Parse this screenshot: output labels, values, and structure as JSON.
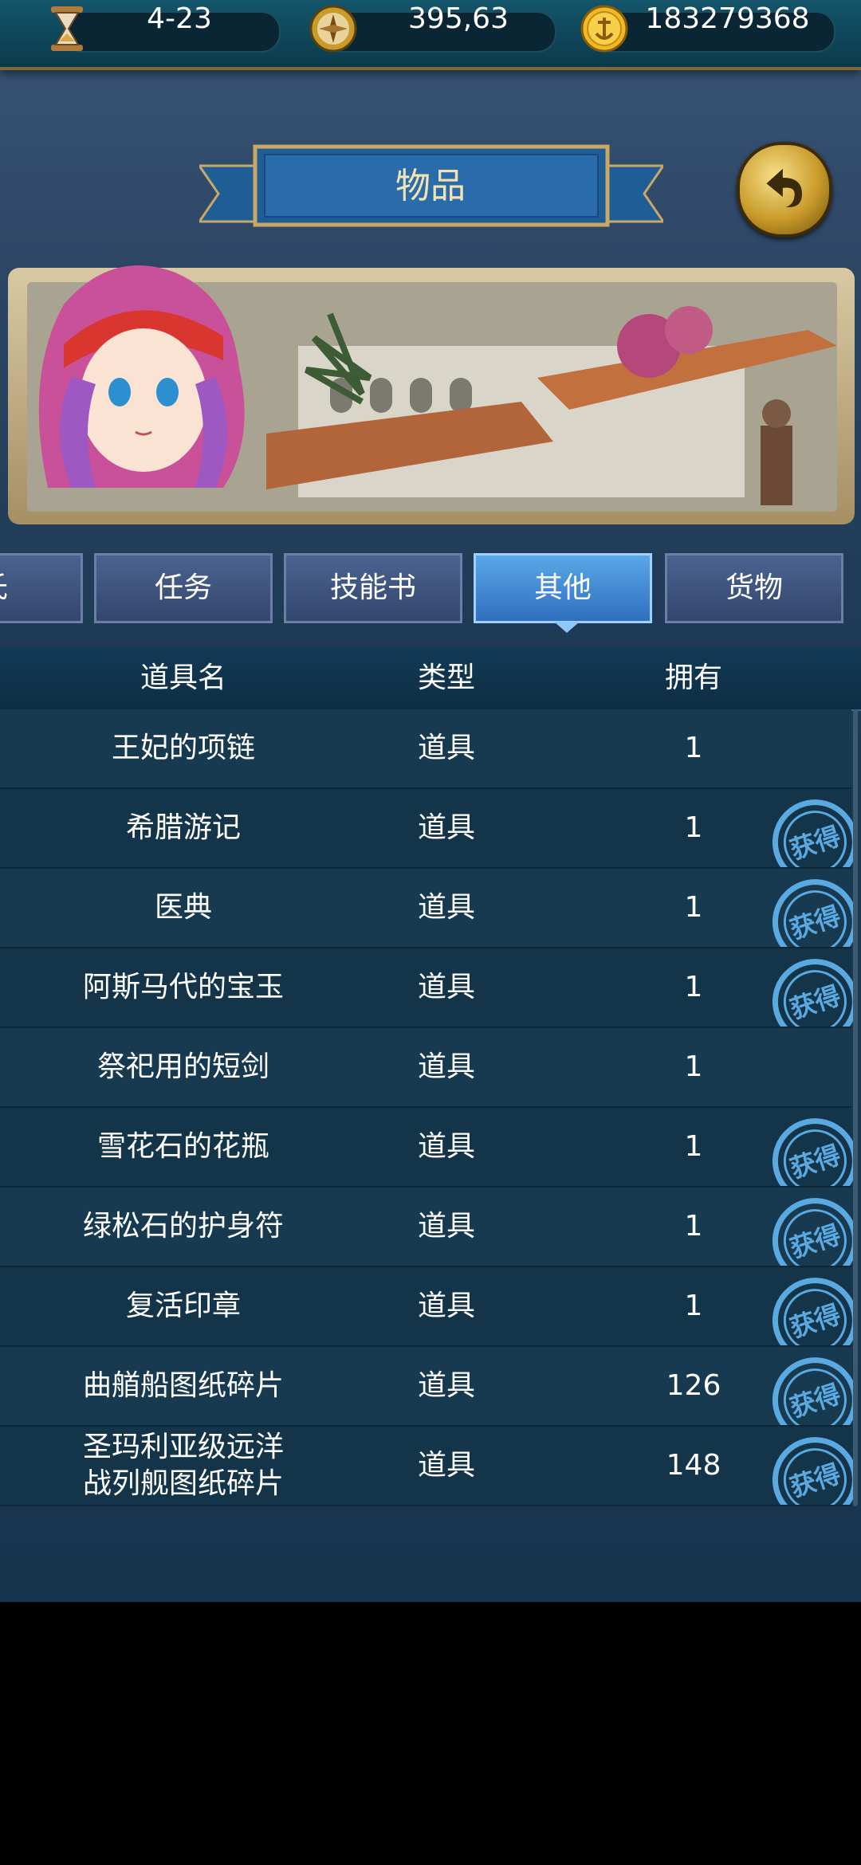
{
  "status_bar": {
    "date": "4-23",
    "compass_value": "395,63",
    "gold": "183279368"
  },
  "header": {
    "title": "物品"
  },
  "tabs": [
    {
      "label": "氏"
    },
    {
      "label": "任务"
    },
    {
      "label": "技能书"
    },
    {
      "label": "其他"
    },
    {
      "label": "货物"
    }
  ],
  "active_tab": "其他",
  "table": {
    "columns": [
      "道具名",
      "类型",
      "拥有"
    ],
    "stamp_label": "获得",
    "rows": [
      {
        "name": "王妃的项链",
        "type": "道具",
        "owned": "1",
        "obtain": false
      },
      {
        "name": "希腊游记",
        "type": "道具",
        "owned": "1",
        "obtain": true
      },
      {
        "name": "医典",
        "type": "道具",
        "owned": "1",
        "obtain": true
      },
      {
        "name": "阿斯马代的宝玉",
        "type": "道具",
        "owned": "1",
        "obtain": true
      },
      {
        "name": "祭祀用的短剑",
        "type": "道具",
        "owned": "1",
        "obtain": false
      },
      {
        "name": "雪花石的花瓶",
        "type": "道具",
        "owned": "1",
        "obtain": true
      },
      {
        "name": "绿松石的护身符",
        "type": "道具",
        "owned": "1",
        "obtain": true
      },
      {
        "name": "复活印章",
        "type": "道具",
        "owned": "1",
        "obtain": true
      },
      {
        "name": "曲艏船图纸碎片",
        "type": "道具",
        "owned": "126",
        "obtain": true
      },
      {
        "name": "圣玛利亚级远洋\n战列舰图纸碎片",
        "type": "道具",
        "owned": "148",
        "obtain": true
      }
    ]
  },
  "colors": {
    "accent_gold": "#c99b2a",
    "active_tab": "#3a86d6",
    "stamp_blue": "#5aa9e0"
  }
}
